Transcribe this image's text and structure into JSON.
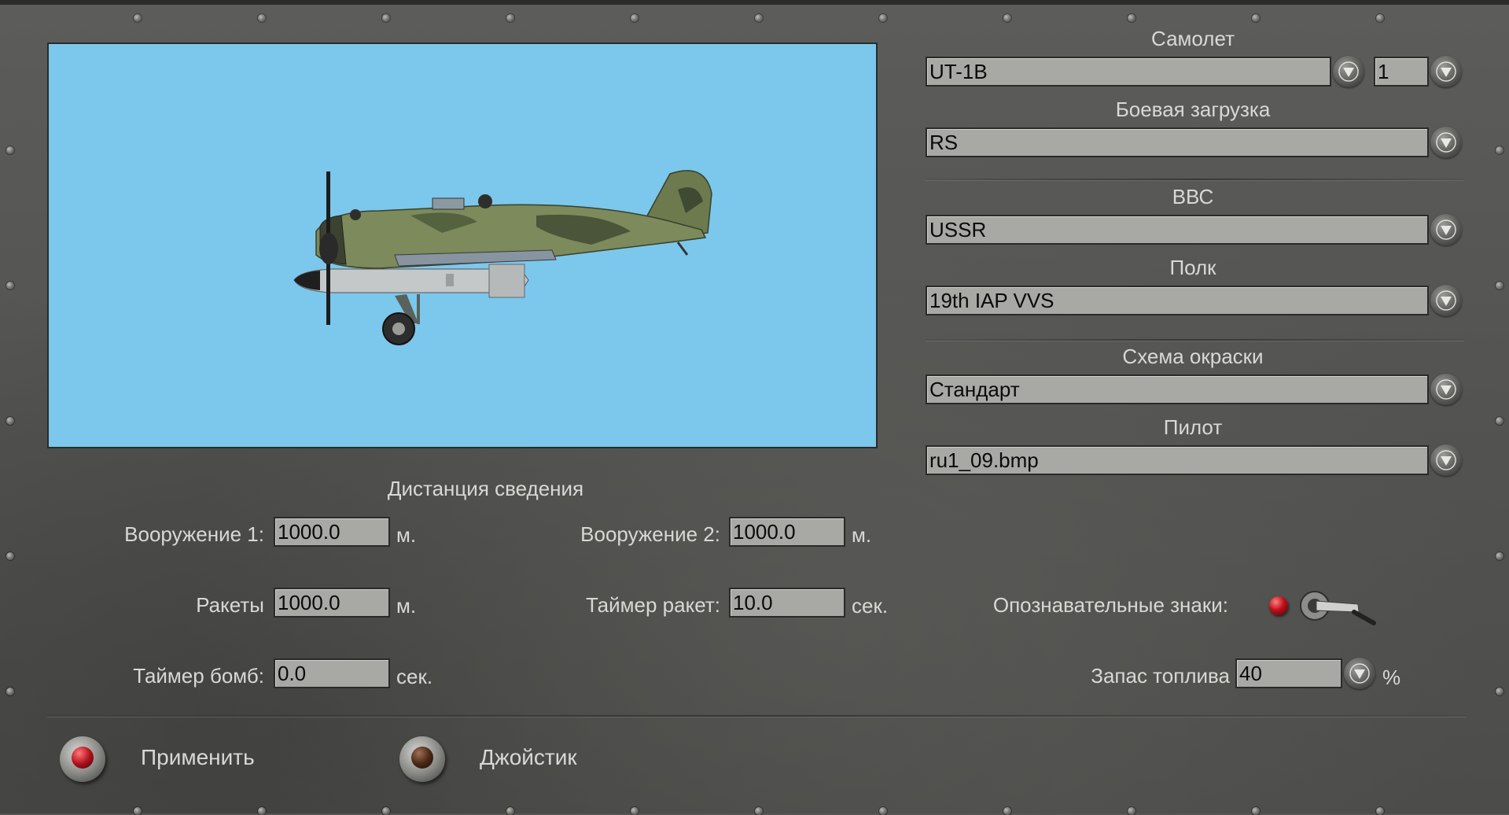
{
  "aircraft_section": {
    "title": "Самолет",
    "aircraft_value": "UT-1B",
    "count_value": "1",
    "loadout_title": "Боевая загрузка",
    "loadout_value": "RS"
  },
  "airforce_section": {
    "country_title": "ВВС",
    "country_value": "USSR",
    "regiment_title": "Полк",
    "regiment_value": "19th IAP VVS"
  },
  "appearance_section": {
    "skin_title": "Схема окраски",
    "skin_value": "Стандарт",
    "pilot_title": "Пилот",
    "pilot_value": "ru1_09.bmp"
  },
  "convergence": {
    "title": "Дистанция сведения",
    "weapon1_label": "Вооружение 1:",
    "weapon1_value": "1000.0",
    "weapon1_unit": "м.",
    "weapon2_label": "Вооружение 2:",
    "weapon2_value": "1000.0",
    "weapon2_unit": "м.",
    "rockets_label": "Ракеты",
    "rockets_value": "1000.0",
    "rockets_unit": "м.",
    "rocket_timer_label": "Таймер ракет:",
    "rocket_timer_value": "10.0",
    "rocket_timer_unit": "сек.",
    "bomb_timer_label": "Таймер бомб:",
    "bomb_timer_value": "0.0",
    "bomb_timer_unit": "сек."
  },
  "markings": {
    "label": "Опознавательные знаки:",
    "indicator_color": "#c0101a"
  },
  "fuel": {
    "label": "Запас топлива",
    "value": "40",
    "unit": "%"
  },
  "buttons": {
    "apply_label": "Применить",
    "apply_color": "#b3121c",
    "joystick_label": "Джойстик",
    "joystick_color": "#4a2a14"
  },
  "preview": {
    "background_color": "#7cc7ec"
  }
}
